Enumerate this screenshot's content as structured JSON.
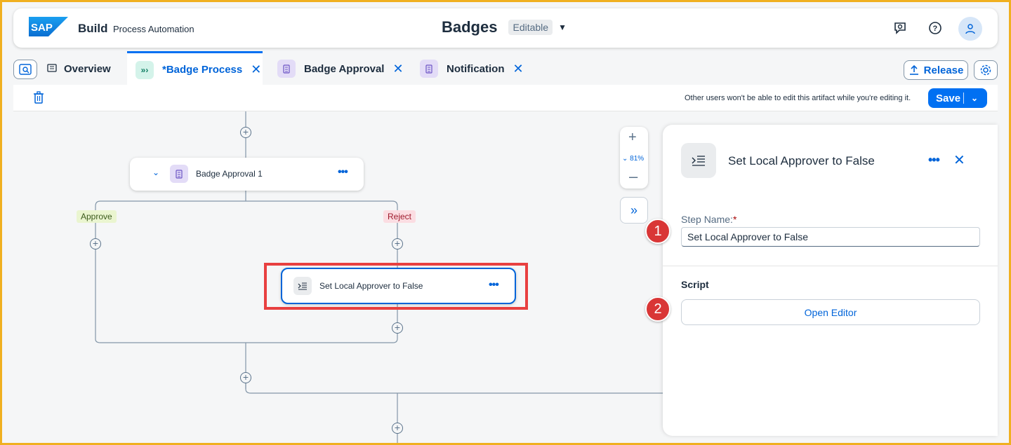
{
  "shell": {
    "logo_text": "SAP",
    "brand": "Build",
    "product": "Process Automation",
    "doc_title": "Badges",
    "status": "Editable",
    "icons": [
      "feedback-icon",
      "help-icon",
      "user-avatar-icon"
    ]
  },
  "tabs": {
    "items": [
      {
        "label": "Overview",
        "icon": "overview-icon"
      },
      {
        "label": "*Badge Process",
        "icon": "process-icon",
        "active": true
      },
      {
        "label": "Badge Approval",
        "icon": "form-icon"
      },
      {
        "label": "Notification",
        "icon": "form-icon"
      }
    ],
    "release_label": "Release"
  },
  "toolbar": {
    "message": "Other users won't be able to edit this artifact while you're editing it.",
    "save_label": "Save"
  },
  "canvas": {
    "approval_node_label": "Badge Approval 1",
    "approve_tag": "Approve",
    "reject_tag": "Reject",
    "script_node_label": "Set Local Approver to False",
    "zoom_level": "81%"
  },
  "panel": {
    "title": "Set Local Approver to False",
    "step_name_label": "Step Name:",
    "required_marker": "*",
    "step_name_value": "Set Local Approver to False",
    "script_section": "Script",
    "open_editor_label": "Open Editor"
  },
  "callouts": [
    "1",
    "2"
  ],
  "colors": {
    "accent": "#0070f2",
    "highlight": "#e84040",
    "approve_bg": "#eaf5d0",
    "reject_bg": "#fbdde2"
  }
}
